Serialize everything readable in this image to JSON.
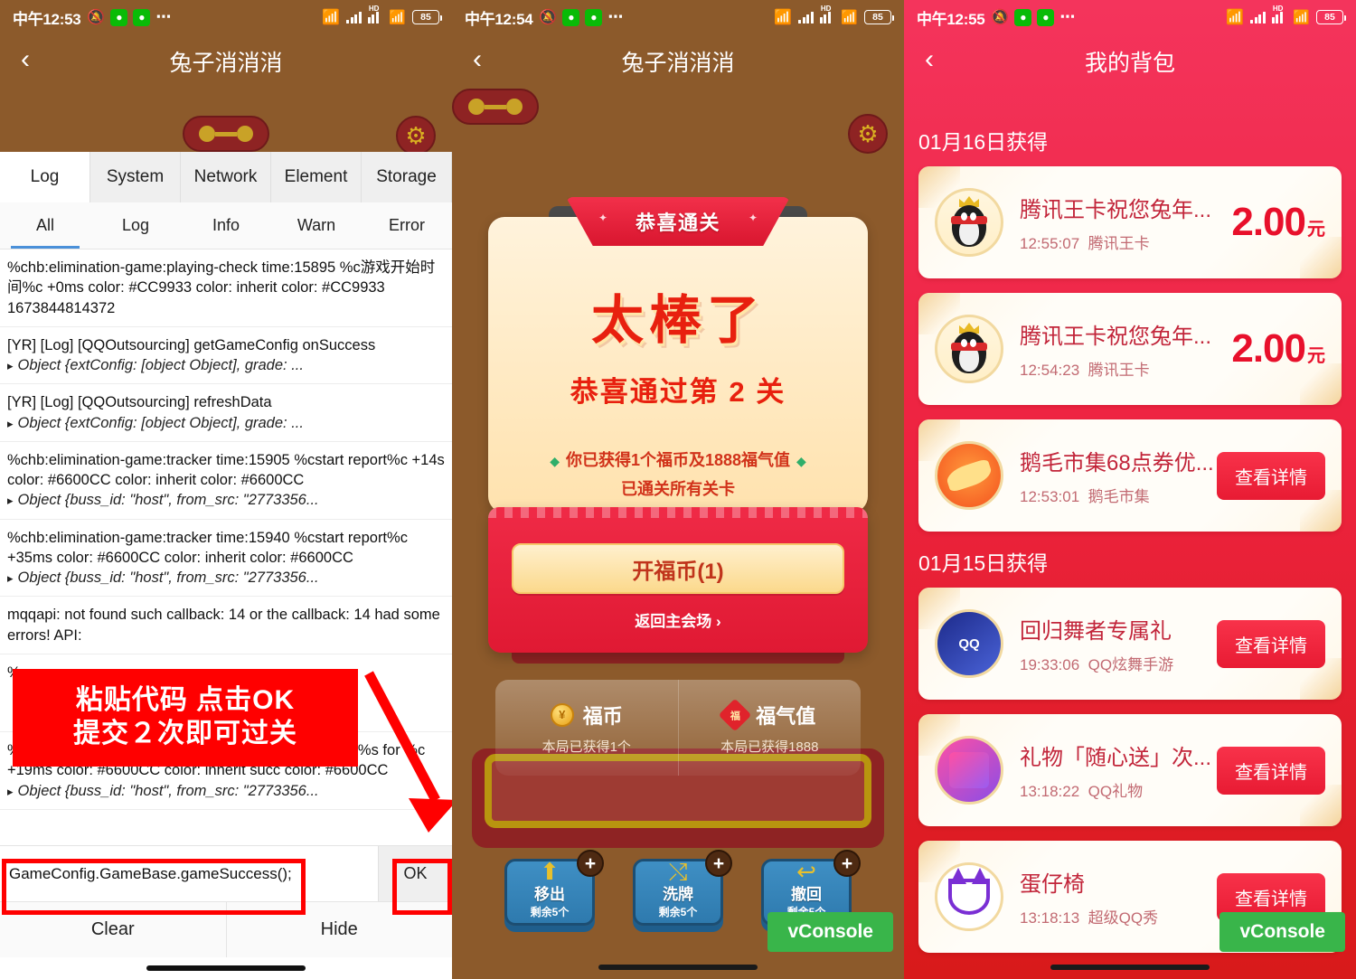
{
  "panel1": {
    "status": {
      "time": "中午12:53",
      "battery": "85",
      "hd": "HD",
      "dots": "⋯"
    },
    "app": {
      "title": "兔子消消消",
      "back": "‹"
    },
    "vconsole": {
      "tabs": [
        {
          "label": "Log",
          "active": true
        },
        {
          "label": "System",
          "active": false
        },
        {
          "label": "Network",
          "active": false
        },
        {
          "label": "Element",
          "active": false
        },
        {
          "label": "Storage",
          "active": false
        }
      ],
      "filters": [
        {
          "label": "All",
          "active": true
        },
        {
          "label": "Log",
          "active": false
        },
        {
          "label": "Info",
          "active": false
        },
        {
          "label": "Warn",
          "active": false
        },
        {
          "label": "Error",
          "active": false
        }
      ],
      "logs": [
        {
          "text": "%chb:elimination-game:playing-check time:15895 %c游戏开始时间%c +0ms color: #CC9933 color: inherit color: #CC9933 1673844814372",
          "obj": ""
        },
        {
          "text": "[YR] [Log] [QQOutsourcing] getGameConfig onSuccess",
          "obj": "Object {extConfig: [object Object], grade: ..."
        },
        {
          "text": "[YR] [Log] [QQOutsourcing] refreshData",
          "obj": "Object {extConfig: [object Object], grade: ..."
        },
        {
          "text": "%chb:elimination-game:tracker time:15905 %cstart report%c +14s color: #6600CC color: inherit color: #6600CC",
          "obj": "Object {buss_id: \"host\", from_src: \"2773356..."
        },
        {
          "text": "%chb:elimination-game:tracker time:15940 %cstart report%c +35ms color: #6600CC color: inherit color: #6600CC",
          "obj": "Object {buss_id: \"host\", from_src: \"2773356..."
        },
        {
          "text": "mqqapi: not found such callback: 14 or the callback: 14 had some errors! API:",
          "obj": ""
        },
        {
          "text": "%",
          "obj": ""
        },
        {
          "text": "%chb:elimination-game:tracker time:15983 %creport %s for %c +19ms color: #6600CC color: inherit succ color: #6600CC",
          "obj": "Object {buss_id: \"host\", from_src: \"2773356..."
        }
      ],
      "input_value": "GameConfig.GameBase.gameSuccess();",
      "input_placeholder": "",
      "ok_label": "OK",
      "clear_label": "Clear",
      "hide_label": "Hide"
    },
    "annotation": {
      "line1": "粘贴代码 点击OK",
      "line2": "提交２次即可过关"
    }
  },
  "panel2": {
    "status": {
      "time": "中午12:54",
      "battery": "85",
      "hd": "HD",
      "dots": "⋯"
    },
    "app": {
      "title": "兔子消消消",
      "back": "‹"
    },
    "modal": {
      "ribbon": "恭喜通关",
      "headline": "太棒了",
      "subheadline": "恭喜通过第 2 关",
      "reward_line": "你已获得1个福币及1888福气值",
      "clear_line": "已通关所有关卡",
      "cta": "开福币(1)",
      "back_link": "返回主会场 ›"
    },
    "stats": [
      {
        "name": "福币",
        "sub": "本局已获得1个",
        "icon": "coin-icon",
        "glyph": "¥"
      },
      {
        "name": "福气值",
        "sub": "本局已获得1888",
        "icon": "fu-icon",
        "glyph": "福"
      }
    ],
    "tools": [
      {
        "label": "移出",
        "count": "剩余5个",
        "glyph": "⬆",
        "plus": "+"
      },
      {
        "label": "洗牌",
        "count": "剩余5个",
        "glyph": "⤭",
        "plus": "+"
      },
      {
        "label": "撤回",
        "count": "剩余5个",
        "glyph": "↩",
        "plus": "+"
      }
    ],
    "fab": "vConsole"
  },
  "panel3": {
    "status": {
      "time": "中午12:55",
      "battery": "85",
      "hd": "HD",
      "dots": "⋯"
    },
    "app": {
      "title": "我的背包",
      "back": "‹"
    },
    "sections": [
      {
        "title": "01月16日获得",
        "items": [
          {
            "title": "腾讯王卡祝您兔年...",
            "time": "12:55:07",
            "source": "腾讯王卡",
            "amount": "2.00",
            "unit": "元",
            "action": "",
            "avatar": "qq-penguin-icon"
          },
          {
            "title": "腾讯王卡祝您兔年...",
            "time": "12:54:23",
            "source": "腾讯王卡",
            "amount": "2.00",
            "unit": "元",
            "action": "",
            "avatar": "qq-penguin-icon"
          },
          {
            "title": "鹅毛市集68点券优...",
            "time": "12:53:01",
            "source": "鹅毛市集",
            "amount": "",
            "unit": "",
            "action": "查看详情",
            "avatar": "feather-market-icon"
          }
        ]
      },
      {
        "title": "01月15日获得",
        "items": [
          {
            "title": "回归舞者专属礼",
            "time": "19:33:06",
            "source": "QQ炫舞手游",
            "amount": "",
            "unit": "",
            "action": "查看详情",
            "avatar": "qq-dance-icon"
          },
          {
            "title": "礼物「随心送」次...",
            "time": "13:18:22",
            "source": "QQ礼物",
            "amount": "",
            "unit": "",
            "action": "查看详情",
            "avatar": "qq-gift-icon"
          },
          {
            "title": "蛋仔椅",
            "time": "13:18:13",
            "source": "超级QQ秀",
            "amount": "",
            "unit": "",
            "action": "查看详情",
            "avatar": "eggy-chair-icon"
          }
        ]
      }
    ],
    "fab": "vConsole"
  },
  "colors": {
    "game_bg": "#8C5A2B",
    "accent_red": "#E8102B",
    "backpack_top": "#F4345C",
    "backpack_bottom": "#D81A1A",
    "annotation_red": "#FF0000",
    "vconsole_green": "#39B54A"
  }
}
